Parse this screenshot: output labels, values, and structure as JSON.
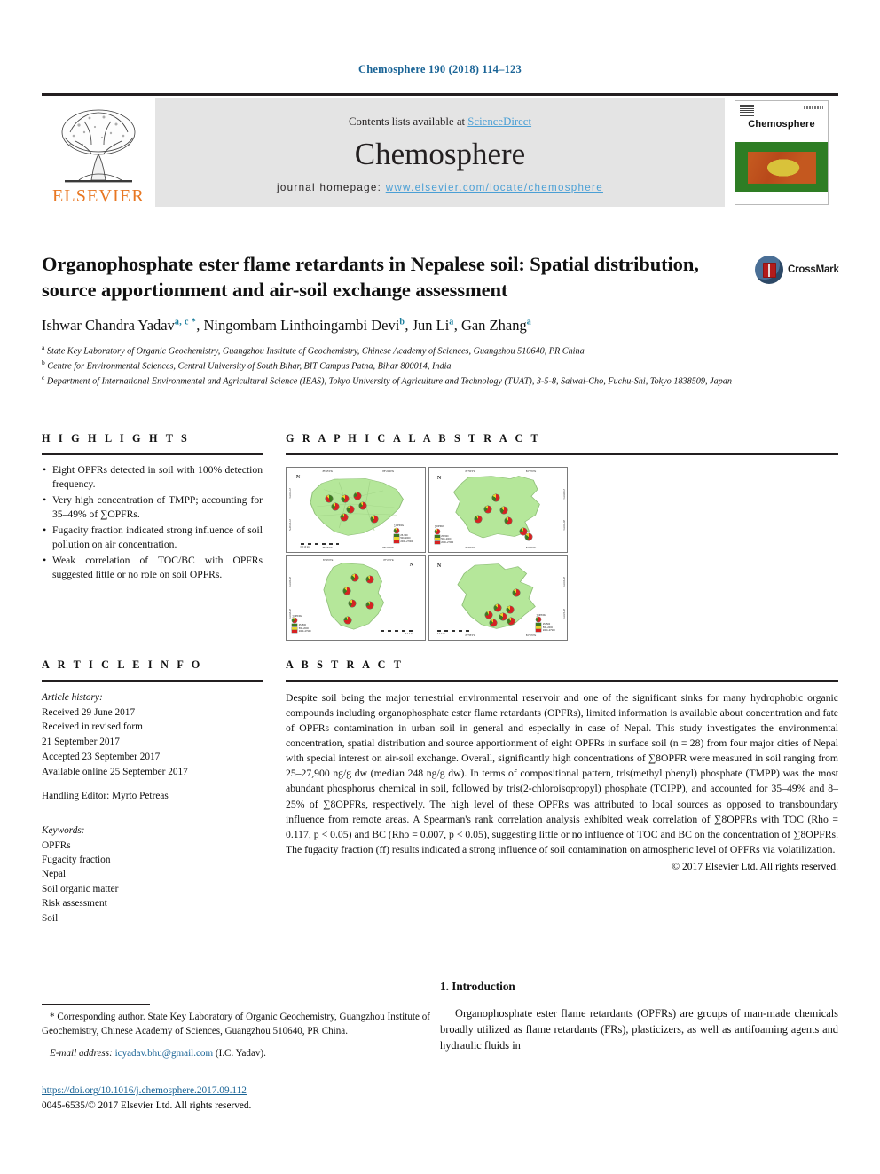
{
  "running_head": "Chemosphere 190 (2018) 114–123",
  "masthead": {
    "contents_prefix": "Contents lists available at ",
    "sciencedirect": "ScienceDirect",
    "journal_name": "Chemosphere",
    "homepage_prefix": "journal homepage: ",
    "homepage_url": "www.elsevier.com/locate/chemosphere",
    "publisher_logo_text": "ELSEVIER",
    "cover_title": "Chemosphere"
  },
  "title": "Organophosphate ester flame retardants in Nepalese soil: Spatial distribution, source apportionment and air-soil exchange assessment",
  "crossmark_label": "CrossMark",
  "authors": [
    {
      "name": "Ishwar Chandra Yadav",
      "marks": "a, c *"
    },
    {
      "name": "Ningombam Linthoingambi Devi",
      "marks": "b"
    },
    {
      "name": "Jun Li",
      "marks": "a"
    },
    {
      "name": "Gan Zhang",
      "marks": "a"
    }
  ],
  "affiliations": [
    {
      "mark": "a",
      "text": "State Key Laboratory of Organic Geochemistry, Guangzhou Institute of Geochemistry, Chinese Academy of Sciences, Guangzhou 510640, PR China"
    },
    {
      "mark": "b",
      "text": "Centre for Environmental Sciences, Central University of South Bihar, BIT Campus Patna, Bihar 800014, India"
    },
    {
      "mark": "c",
      "text": "Department of International Environmental and Agricultural Science (IEAS), Tokyo University of Agriculture and Technology (TUAT), 3-5-8, Saiwai-Cho, Fuchu-Shi, Tokyo 1838509, Japan"
    }
  ],
  "highlights": {
    "heading": "H I G H L I G H T S",
    "items": [
      "Eight OPFRs detected in soil with 100% detection frequency.",
      "Very high concentration of TMPP; accounting for 35–49% of ∑OPFRs.",
      "Fugacity fraction indicated strong influence of soil pollution on air concentration.",
      "Weak correlation of TOC/BC with OPFRs suggested little or no role on soil OPFRs."
    ]
  },
  "graphical_abstract": {
    "heading": "G R A P H I C A L  A B S T R A C T",
    "maps": [
      {
        "name": "kathmandu",
        "north_label": "N",
        "ticks_top": [
          "85°15'0\"E",
          "85°22'30\"E"
        ],
        "ticks_bottom": [
          "85°15'0\"E",
          "85°22'30\"E"
        ],
        "ticks_left": [
          "27°45'0\"N",
          "27°37'30\"N"
        ],
        "legend_title": "∑OPFRs",
        "legend_entries": [
          "25–500",
          "500–2000",
          "2000–27900"
        ],
        "scale_label": "0  5  10 km"
      },
      {
        "name": "birgunj",
        "north_label": "N",
        "ticks_top": [
          "84°50'0\"E",
          "84°55'0\"E"
        ],
        "ticks_bottom": [
          "84°50'0\"E",
          "84°55'0\"E"
        ],
        "ticks_right": [
          "27°00'0\"N",
          "26°55'0\"N"
        ],
        "legend_title": "∑OPFRs",
        "legend_entries": [
          "25–500",
          "500–2000",
          "2000–27900"
        ],
        "scale_label": "0  2  4 km"
      },
      {
        "name": "biratnagar",
        "north_label": "N",
        "ticks_top": [
          "87°15'0\"E",
          "87°20'0\"E"
        ],
        "ticks_left": [
          "26°30'0\"N",
          "26°25'0\"N"
        ],
        "legend_title": "∑OPFRs",
        "legend_entries": [
          "25–500",
          "500–2000",
          "2000–27900"
        ],
        "scale_label": "0  2  4 km"
      },
      {
        "name": "pokhara",
        "north_label": "N",
        "ticks_bottom": [
          "83°55'0\"E",
          "84°00'0\"E"
        ],
        "ticks_right": [
          "28°15'0\"N",
          "28°10'0\"N"
        ],
        "legend_title": "∑OPFRs",
        "legend_entries": [
          "25–500",
          "500–2000",
          "2000–27900"
        ],
        "scale_label": "0  2  4 km"
      }
    ],
    "colors": {
      "land": "#b5e79a",
      "pie_red": "#d62222",
      "pie_yellow": "#e8d531",
      "pie_green": "#3c7a1e"
    }
  },
  "article_info": {
    "heading": "A R T I C L E  I N F O",
    "history_label": "Article history:",
    "history": [
      "Received 29 June 2017",
      "Received in revised form",
      "21 September 2017",
      "Accepted 23 September 2017",
      "Available online 25 September 2017"
    ],
    "handling_editor": "Handling Editor: Myrto Petreas",
    "keywords_label": "Keywords:",
    "keywords": [
      "OPFRs",
      "Fugacity fraction",
      "Nepal",
      "Soil organic matter",
      "Risk assessment",
      "Soil"
    ]
  },
  "abstract": {
    "heading": "A B S T R A C T",
    "text": "Despite soil being the major terrestrial environmental reservoir and one of the significant sinks for many hydrophobic organic compounds including organophosphate ester flame retardants (OPFRs), limited information is available about concentration and fate of OPFRs contamination in urban soil in general and especially in case of Nepal. This study investigates the environmental concentration, spatial distribution and source apportionment of eight OPFRs in surface soil (n = 28) from four major cities of Nepal with special interest on air-soil exchange. Overall, significantly high concentrations of ∑8OPFR were measured in soil ranging from 25–27,900 ng/g dw (median 248 ng/g dw). In terms of compositional pattern, tris(methyl phenyl) phosphate (TMPP) was the most abundant phosphorus chemical in soil, followed by tris(2-chloroisopropyl) phosphate (TCIPP), and accounted for 35–49% and 8–25% of ∑8OPFRs, respectively. The high level of these OPFRs was attributed to local sources as opposed to transboundary influence from remote areas. A Spearman's rank correlation analysis exhibited weak correlation of ∑8OPFRs with TOC (Rho = 0.117, p < 0.05) and BC (Rho = 0.007, p < 0.05), suggesting little or no influence of TOC and BC on the concentration of ∑8OPFRs. The fugacity fraction (ff) results indicated a strong influence of soil contamination on atmospheric level of OPFRs via volatilization.",
    "copyright": "© 2017 Elsevier Ltd. All rights reserved."
  },
  "footnote": {
    "corresponding": "* Corresponding author. State Key Laboratory of Organic Geochemistry, Guangzhou Institute of Geochemistry, Chinese Academy of Sciences, Guangzhou 510640, PR China.",
    "email_label": "E-mail address:",
    "email": "icyadav.bhu@gmail.com",
    "email_suffix": "(I.C. Yadav)."
  },
  "doi_block": {
    "doi": "https://doi.org/10.1016/j.chemosphere.2017.09.112",
    "issn_line": "0045-6535/© 2017 Elsevier Ltd. All rights reserved."
  },
  "introduction": {
    "heading": "1. Introduction",
    "paragraph": "Organophosphate ester flame retardants (OPFRs) are groups of man-made chemicals broadly utilized as flame retardants (FRs), plasticizers, as well as antifoaming agents and hydraulic fluids in"
  }
}
